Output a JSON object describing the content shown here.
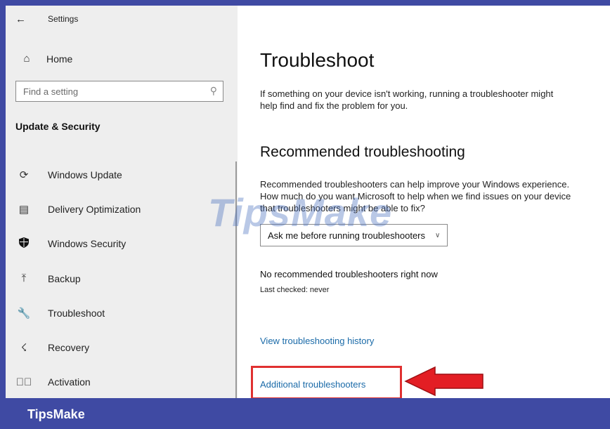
{
  "window": {
    "title": "Settings",
    "back_icon": "back-arrow-icon"
  },
  "sidebar": {
    "home": {
      "label": "Home",
      "icon": "home-icon"
    },
    "search": {
      "placeholder": "Find a setting",
      "icon": "search-icon"
    },
    "section_title": "Update & Security",
    "items": [
      {
        "label": "Windows Update",
        "icon": "sync-icon"
      },
      {
        "label": "Delivery Optimization",
        "icon": "delivery-optimization-icon"
      },
      {
        "label": "Windows Security",
        "icon": "shield-icon"
      },
      {
        "label": "Backup",
        "icon": "upload-icon"
      },
      {
        "label": "Troubleshoot",
        "icon": "wrench-icon"
      },
      {
        "label": "Recovery",
        "icon": "recovery-icon"
      },
      {
        "label": "Activation",
        "icon": "check-circle-icon"
      }
    ]
  },
  "main": {
    "title": "Troubleshoot",
    "intro": "If something on your device isn't working, running a troubleshooter might help find and fix the problem for you.",
    "recommended": {
      "heading": "Recommended troubleshooting",
      "description": "Recommended troubleshooters can help improve your Windows experience. How much do you want Microsoft to help when we find issues on your device that troubleshooters might be able to fix?",
      "dropdown_value": "Ask me before running troubleshooters",
      "status": "No recommended troubleshooters right now",
      "last_checked": "Last checked: never"
    },
    "history_link": "View troubleshooting history",
    "additional_link": "Additional troubleshooters"
  },
  "watermark": "TipsMake",
  "footer": {
    "brand": "TipsMake"
  },
  "colors": {
    "accent_link": "#1a6aa8",
    "highlight": "#e03030",
    "brand_bar": "#3f4aa3"
  }
}
